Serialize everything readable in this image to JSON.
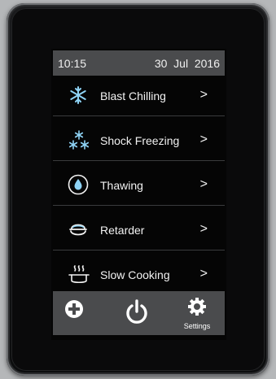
{
  "status": {
    "time": "10:15",
    "date": "30  Jul  2016"
  },
  "menu": [
    {
      "label": "Blast Chilling",
      "icon": "snowflake-icon",
      "chevron": ">"
    },
    {
      "label": "Shock Freezing",
      "icon": "multi-snowflake-icon",
      "chevron": ">"
    },
    {
      "label": "Thawing",
      "icon": "water-drop-icon",
      "chevron": ">"
    },
    {
      "label": "Retarder",
      "icon": "dough-bowl-icon",
      "chevron": ">"
    },
    {
      "label": "Slow Cooking",
      "icon": "cooking-pot-icon",
      "chevron": ">"
    }
  ],
  "bottom": {
    "add_icon": "plus-circle-icon",
    "power_icon": "power-icon",
    "settings_icon": "gear-icon",
    "settings_label": "Settings"
  },
  "colors": {
    "bar": "#4a4b4d",
    "accent": "#8fd3f5",
    "screen_bg": "#050505"
  }
}
